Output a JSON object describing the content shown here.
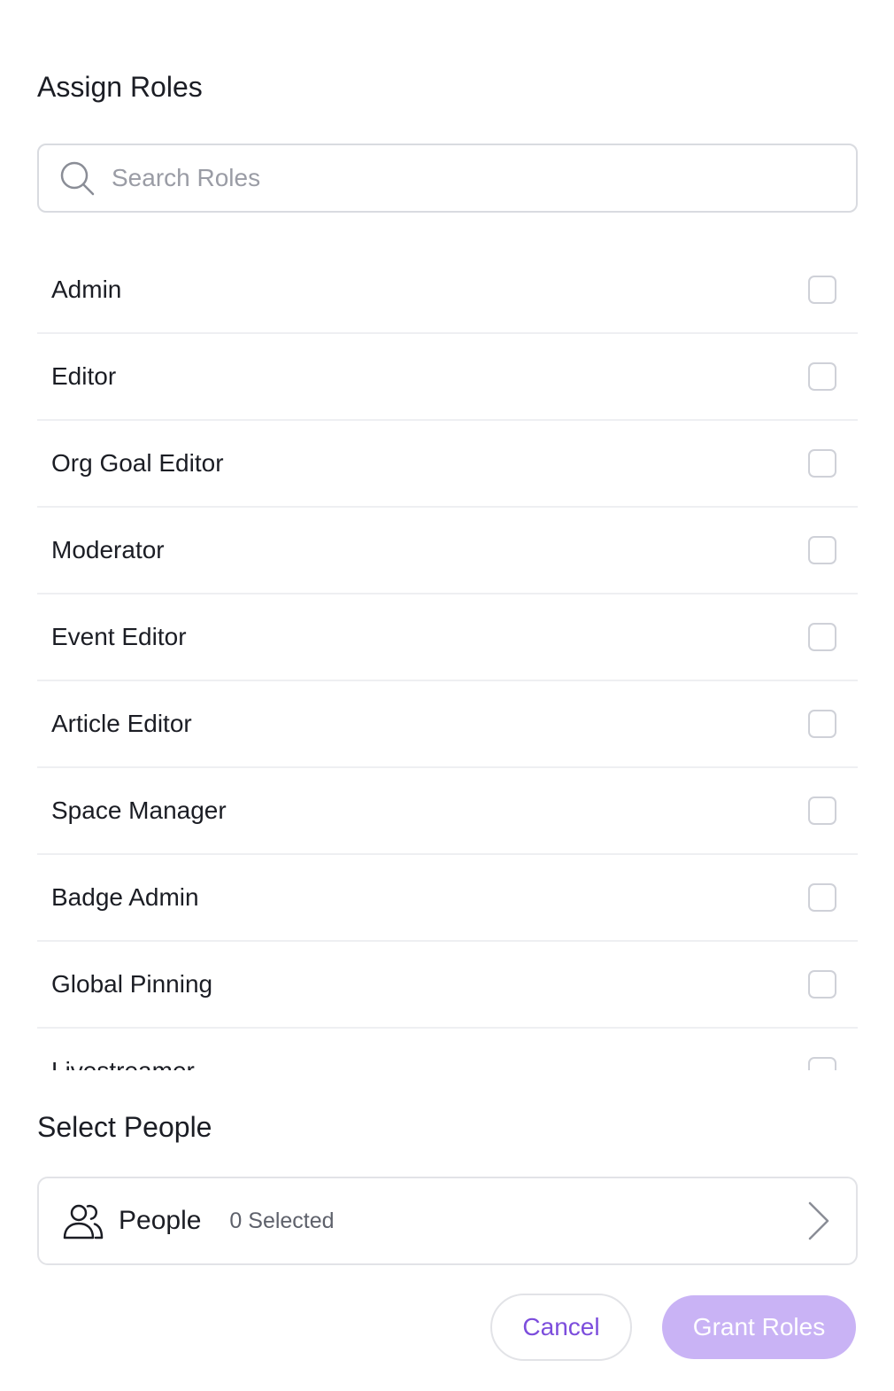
{
  "header": {
    "title": "Assign Roles"
  },
  "search": {
    "placeholder": "Search Roles",
    "value": ""
  },
  "roles": [
    {
      "label": "Admin",
      "checked": false
    },
    {
      "label": "Editor",
      "checked": false
    },
    {
      "label": "Org Goal Editor",
      "checked": false
    },
    {
      "label": "Moderator",
      "checked": false
    },
    {
      "label": "Event Editor",
      "checked": false
    },
    {
      "label": "Article Editor",
      "checked": false
    },
    {
      "label": "Space Manager",
      "checked": false
    },
    {
      "label": "Badge Admin",
      "checked": false
    },
    {
      "label": "Global Pinning",
      "checked": false
    },
    {
      "label": "Livestreamer",
      "checked": false
    }
  ],
  "people_section": {
    "title": "Select People",
    "label": "People",
    "count_text": "0 Selected",
    "icon": "users-icon"
  },
  "actions": {
    "cancel_label": "Cancel",
    "grant_label": "Grant Roles"
  },
  "colors": {
    "accent": "#7c4ddc",
    "accent_disabled": "#c9b3f5",
    "border": "#d9dbe0"
  }
}
